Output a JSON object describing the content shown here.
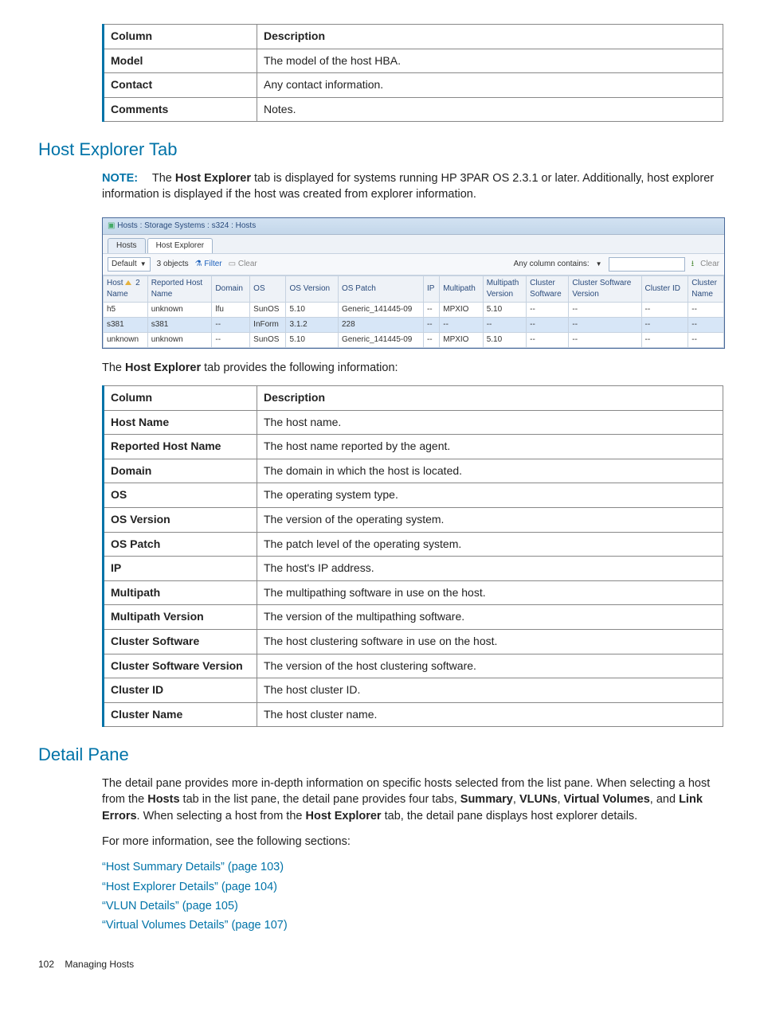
{
  "top_table": {
    "headers": [
      "Column",
      "Description"
    ],
    "rows": [
      [
        "Model",
        "The model of the host HBA."
      ],
      [
        "Contact",
        "Any contact information."
      ],
      [
        "Comments",
        "Notes."
      ]
    ]
  },
  "section1": {
    "title": "Host Explorer Tab",
    "note_label": "NOTE:",
    "note_pre": "The ",
    "note_bold": "Host Explorer",
    "note_post": " tab is displayed for systems running HP 3PAR OS 2.3.1 or later. Additionally, host explorer information is displayed if the host was created from explorer information."
  },
  "screenshot": {
    "title": "Hosts : Storage Systems : s324 : Hosts",
    "tabs": [
      "Hosts",
      "Host Explorer"
    ],
    "active_tab_index": 1,
    "left_controls": {
      "default_label": "Default",
      "objects_label": "3 objects",
      "filter_label": "Filter",
      "clear_small": "Clear"
    },
    "right_controls": {
      "any_col_label": "Any column contains:",
      "search_value": "",
      "clear_label": "Clear"
    },
    "columns": [
      "Host Name",
      "Reported Host Name",
      "Domain",
      "OS",
      "OS Version",
      "OS Patch",
      "IP",
      "Multipath",
      "Multipath Version",
      "Cluster Software",
      "Cluster Software Version",
      "Cluster ID",
      "Cluster Name"
    ],
    "sort_col_index": 0,
    "rows": [
      {
        "sel": false,
        "cells": [
          "h5",
          "unknown",
          "lfu",
          "SunOS",
          "5.10",
          "Generic_141445-09",
          "--",
          "MPXIO",
          "5.10",
          "--",
          "--",
          "--",
          "--"
        ]
      },
      {
        "sel": true,
        "cells": [
          "s381",
          "s381",
          "--",
          "InForm",
          "3.1.2",
          "228",
          "--",
          "--",
          "--",
          "--",
          "--",
          "--",
          "--"
        ]
      },
      {
        "sel": false,
        "cells": [
          "unknown",
          "unknown",
          "--",
          "SunOS",
          "5.10",
          "Generic_141445-09",
          "--",
          "MPXIO",
          "5.10",
          "--",
          "--",
          "--",
          "--"
        ]
      }
    ]
  },
  "intro_he": {
    "pre": "The ",
    "bold": "Host Explorer",
    "post": " tab provides the following information:"
  },
  "he_table": {
    "headers": [
      "Column",
      "Description"
    ],
    "rows": [
      [
        "Host Name",
        "The host name."
      ],
      [
        "Reported Host Name",
        "The host name reported by the agent."
      ],
      [
        "Domain",
        "The domain in which the host is located."
      ],
      [
        "OS",
        "The operating system type."
      ],
      [
        "OS Version",
        "The version of the operating system."
      ],
      [
        "OS Patch",
        "The patch level of the operating system."
      ],
      [
        "IP",
        "The host's IP address."
      ],
      [
        "Multipath",
        "The multipathing software in use on the host."
      ],
      [
        "Multipath Version",
        "The version of the multipathing software."
      ],
      [
        "Cluster Software",
        "The host clustering software in use on the host."
      ],
      [
        "Cluster Software Version",
        "The version of the host clustering software."
      ],
      [
        "Cluster ID",
        "The host cluster ID."
      ],
      [
        "Cluster Name",
        "The host cluster name."
      ]
    ]
  },
  "section2": {
    "title": "Detail Pane",
    "para1_a": "The detail pane provides more in-depth information on specific hosts selected from the list pane. When selecting a host from the ",
    "para1_b": "Hosts",
    "para1_c": " tab in the list pane, the detail pane provides four tabs, ",
    "para1_d": "Summary",
    "para1_e": ", ",
    "para1_f": "VLUNs",
    "para1_g": ", ",
    "para1_h": "Virtual Volumes",
    "para1_i": ", and ",
    "para1_j": "Link Errors",
    "para1_k": ". When selecting a host from the ",
    "para1_l": "Host Explorer",
    "para1_m": " tab, the detail pane displays host explorer details.",
    "para2": "For more information, see the following sections:",
    "links": [
      "“Host Summary Details” (page 103)",
      "“Host Explorer Details” (page 104)",
      "“VLUN Details” (page 105)",
      "“Virtual Volumes Details” (page 107)"
    ]
  },
  "footer": {
    "page": "102",
    "section": "Managing Hosts"
  }
}
